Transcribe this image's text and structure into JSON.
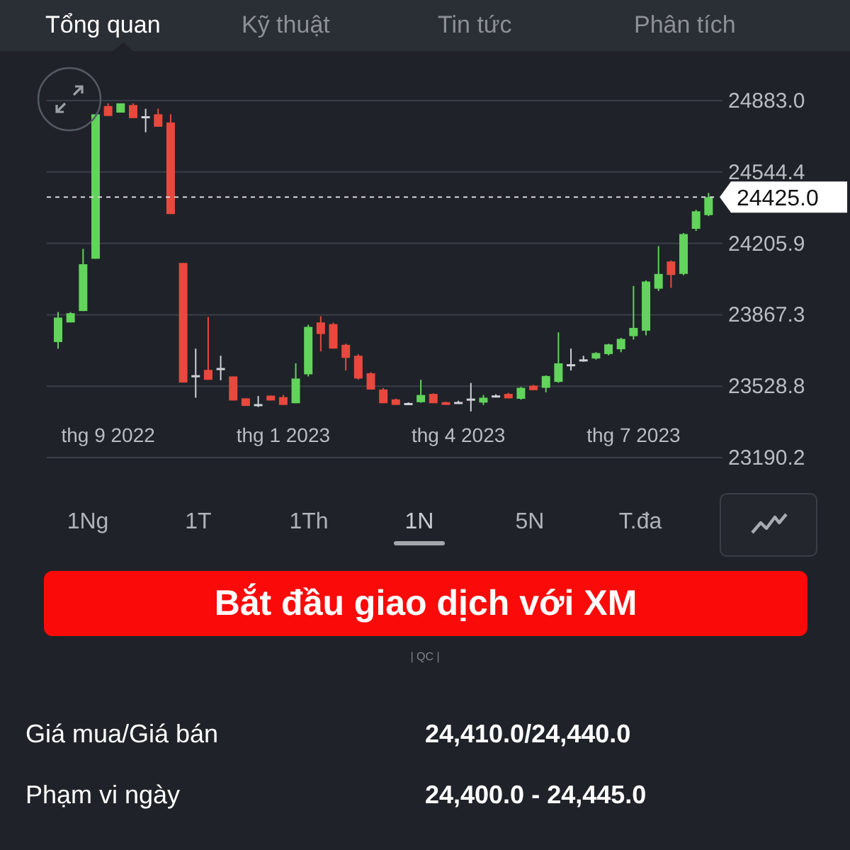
{
  "tabs": [
    {
      "label": "Tổng quan",
      "selected": true
    },
    {
      "label": "Kỹ thuật",
      "selected": false
    },
    {
      "label": "Tin tức",
      "selected": false
    },
    {
      "label": "Phân tích",
      "selected": false
    }
  ],
  "chart": {
    "chart_data": {
      "type": "candlestick",
      "ylim": [
        23190.2,
        24883.0
      ],
      "yticks": [
        {
          "value": 24883.0,
          "label": "24883.0"
        },
        {
          "value": 24544.4,
          "label": "24544.4"
        },
        {
          "value": 24205.9,
          "label": "24205.9"
        },
        {
          "value": 23867.3,
          "label": "23867.3"
        },
        {
          "value": 23528.8,
          "label": "23528.8"
        },
        {
          "value": 23190.2,
          "label": "23190.2"
        }
      ],
      "categories": [
        null,
        null,
        null,
        null,
        "thg 9 2022",
        null,
        null,
        null,
        null,
        null,
        null,
        null,
        null,
        null,
        null,
        null,
        null,
        null,
        "thg 1 2023",
        null,
        null,
        null,
        null,
        null,
        null,
        null,
        null,
        null,
        null,
        null,
        null,
        null,
        "thg 4 2023",
        null,
        null,
        null,
        null,
        null,
        null,
        null,
        null,
        null,
        null,
        null,
        null,
        null,
        "thg 7 2023",
        null,
        null,
        null,
        null,
        null,
        null
      ],
      "grid": true,
      "ref_lines": [
        {
          "axis": "y",
          "value": 24425.0,
          "label": "24425.0"
        }
      ],
      "ohlc": [
        [
          23738,
          23880,
          23707,
          23854
        ],
        [
          23831,
          23880,
          23831,
          23875
        ],
        [
          23885,
          24180,
          23885,
          24107
        ],
        [
          24133,
          24818,
          24133,
          24818
        ],
        [
          24857,
          24870,
          24810,
          24810
        ],
        [
          24826,
          24870,
          24826,
          24870
        ],
        [
          24862,
          24870,
          24800,
          24800
        ],
        [
          24801,
          24844,
          24733,
          24809
        ],
        [
          24818,
          24844,
          24759,
          24759
        ],
        [
          24779,
          24818,
          24345,
          24345
        ],
        [
          24113,
          24113,
          23546,
          23546
        ],
        [
          23573,
          23707,
          23474,
          23581
        ],
        [
          23606,
          23857,
          23559,
          23559
        ],
        [
          23607,
          23673,
          23557,
          23615
        ],
        [
          23575,
          23575,
          23461,
          23461
        ],
        [
          23471,
          23471,
          23435,
          23435
        ],
        [
          23436,
          23482,
          23430,
          23444
        ],
        [
          23484,
          23484,
          23461,
          23461
        ],
        [
          23477,
          23487,
          23440,
          23440
        ],
        [
          23448,
          23637,
          23448,
          23565
        ],
        [
          23585,
          23820,
          23575,
          23810
        ],
        [
          23831,
          23860,
          23694,
          23776
        ],
        [
          23823,
          23830,
          23707,
          23707
        ],
        [
          23725,
          23730,
          23603,
          23663
        ],
        [
          23673,
          23680,
          23560,
          23565
        ],
        [
          23590,
          23595,
          23513,
          23513
        ],
        [
          23513,
          23520,
          23448,
          23448
        ],
        [
          23466,
          23470,
          23440,
          23440
        ],
        [
          23443,
          23452,
          23440,
          23449
        ],
        [
          23453,
          23559,
          23450,
          23487
        ],
        [
          23492,
          23495,
          23448,
          23448
        ],
        [
          23453,
          23455,
          23440,
          23440
        ],
        [
          23448,
          23460,
          23445,
          23454
        ],
        [
          23462,
          23544,
          23409,
          23470
        ],
        [
          23451,
          23487,
          23440,
          23474
        ],
        [
          23479,
          23490,
          23475,
          23485
        ],
        [
          23492,
          23497,
          23471,
          23471
        ],
        [
          23469,
          23525,
          23465,
          23521
        ],
        [
          23531,
          23535,
          23510,
          23510
        ],
        [
          23521,
          23580,
          23500,
          23577
        ],
        [
          23549,
          23784,
          23545,
          23637
        ],
        [
          23625,
          23707,
          23603,
          23633
        ],
        [
          23648,
          23673,
          23645,
          23656
        ],
        [
          23660,
          23690,
          23655,
          23686
        ],
        [
          23681,
          23730,
          23675,
          23727
        ],
        [
          23704,
          23758,
          23690,
          23753
        ],
        [
          23766,
          24004,
          23750,
          23805
        ],
        [
          23792,
          24030,
          23770,
          24025
        ],
        [
          23991,
          24193,
          23980,
          24061
        ],
        [
          24120,
          24125,
          23995,
          24056
        ],
        [
          24061,
          24255,
          24055,
          24250
        ],
        [
          24275,
          24365,
          24265,
          24358
        ],
        [
          24340,
          24445,
          24335,
          24425
        ]
      ]
    }
  },
  "periods": [
    {
      "label": "1Ng",
      "selected": false
    },
    {
      "label": "1T",
      "selected": false
    },
    {
      "label": "1Th",
      "selected": false
    },
    {
      "label": "1N",
      "selected": true
    },
    {
      "label": "5N",
      "selected": false
    },
    {
      "label": "T.đa",
      "selected": false
    }
  ],
  "trade_button": "Bắt đầu giao dịch với XM",
  "ad_label": "| QC |",
  "rows": [
    {
      "label": "Giá mua/Giá bán",
      "value": "24,410.0/24,440.0"
    },
    {
      "label": "Phạm vi ngày",
      "value": "24,400.0 - 24,445.0"
    }
  ]
}
